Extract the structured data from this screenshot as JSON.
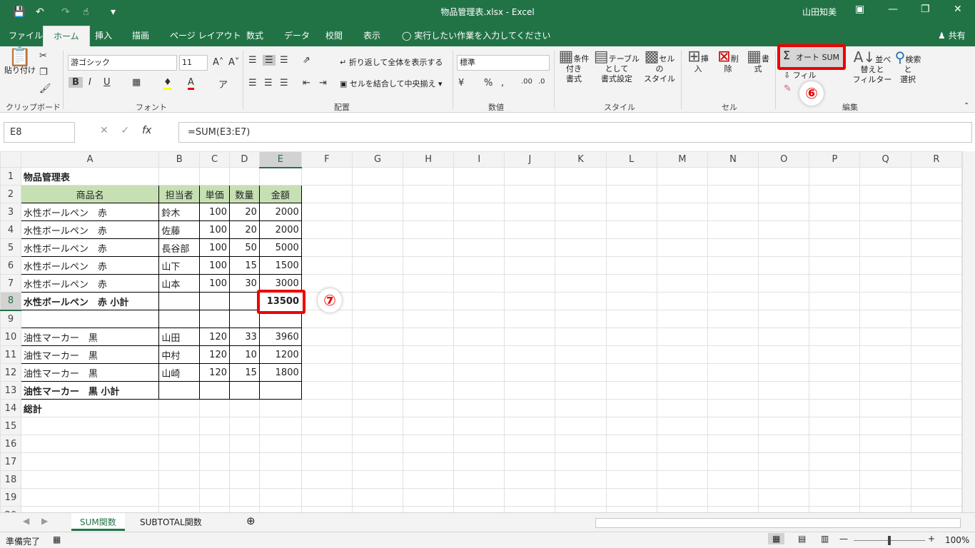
{
  "window": {
    "title": "物品管理表.xlsx  -  Excel",
    "user": "山田知美"
  },
  "tabs": [
    "ファイル",
    "ホーム",
    "挿入",
    "描画",
    "ページ レイアウト",
    "数式",
    "データ",
    "校閲",
    "表示"
  ],
  "tellme": "実行したい作業を入力してください",
  "share": "共有",
  "ribbon": {
    "clipboard": {
      "paste": "貼り付け",
      "label": "クリップボード"
    },
    "font": {
      "name": "游ゴシック",
      "size": "11",
      "label": "フォント"
    },
    "alignment": {
      "wrap": "折り返して全体を表示する",
      "merge": "セルを結合して中央揃え",
      "label": "配置"
    },
    "number": {
      "format": "標準",
      "label": "数値"
    },
    "styles": {
      "cond": "条件付き\n書式",
      "table": "テーブルとして\n書式設定",
      "cell": "セルの\nスタイル",
      "label": "スタイル"
    },
    "cells": {
      "insert": "挿入",
      "delete": "削除",
      "format": "書式",
      "label": "セル"
    },
    "editing": {
      "autosum": "オート SUM",
      "fill": "フィル",
      "sort": "並べ替えと\nフィルター",
      "find": "検索と\n選択",
      "label": "編集"
    }
  },
  "markers": {
    "six": "⑥",
    "seven": "⑦"
  },
  "formula_bar": {
    "name_box": "E8",
    "formula": "=SUM(E3:E7)"
  },
  "columns": [
    "A",
    "B",
    "C",
    "D",
    "E",
    "F",
    "G",
    "H",
    "I",
    "J",
    "K",
    "L",
    "M",
    "N",
    "O",
    "P",
    "Q",
    "R"
  ],
  "rows": [
    [
      "物品管理表",
      "",
      "",
      "",
      ""
    ],
    [
      "商品名",
      "担当者",
      "単価",
      "数量",
      "金額"
    ],
    [
      "水性ボールペン　赤",
      "鈴木",
      "100",
      "20",
      "2000"
    ],
    [
      "水性ボールペン　赤",
      "佐藤",
      "100",
      "20",
      "2000"
    ],
    [
      "水性ボールペン　赤",
      "長谷部",
      "100",
      "50",
      "5000"
    ],
    [
      "水性ボールペン　赤",
      "山下",
      "100",
      "15",
      "1500"
    ],
    [
      "水性ボールペン　赤",
      "山本",
      "100",
      "30",
      "3000"
    ],
    [
      "水性ボールペン　赤 小計",
      "",
      "",
      "",
      "13500"
    ],
    [
      "",
      "",
      "",
      "",
      ""
    ],
    [
      "油性マーカー　黒",
      "山田",
      "120",
      "33",
      "3960"
    ],
    [
      "油性マーカー　黒",
      "中村",
      "120",
      "10",
      "1200"
    ],
    [
      "油性マーカー　黒",
      "山崎",
      "120",
      "15",
      "1800"
    ],
    [
      "油性マーカー　黒 小計",
      "",
      "",
      "",
      ""
    ],
    [
      "総計",
      "",
      "",
      "",
      ""
    ],
    [
      "",
      "",
      "",
      "",
      ""
    ],
    [
      "",
      "",
      "",
      "",
      ""
    ],
    [
      "",
      "",
      "",
      "",
      ""
    ],
    [
      "",
      "",
      "",
      "",
      ""
    ],
    [
      "",
      "",
      "",
      "",
      ""
    ],
    [
      "",
      "",
      "",
      "",
      ""
    ]
  ],
  "sheets": [
    "SUM関数",
    "SUBTOTAL関数"
  ],
  "status": {
    "ready": "準備完了",
    "zoom": "100%"
  }
}
